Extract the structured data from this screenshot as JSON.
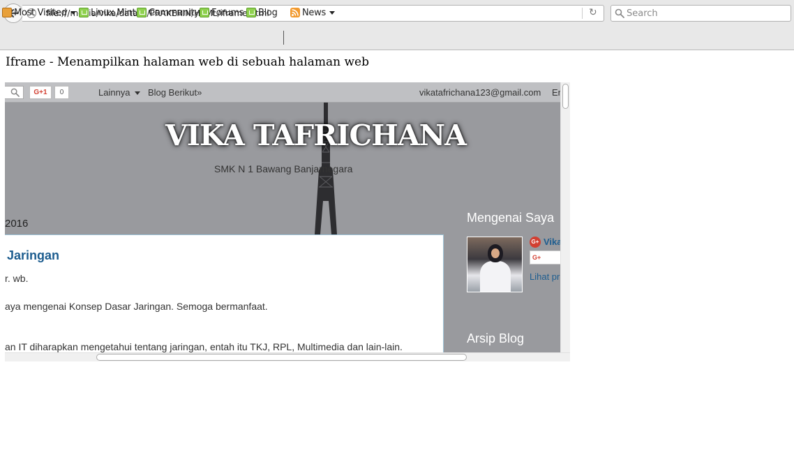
{
  "browser": {
    "url": "file:///media/vika/data D/PRAKERIN/HTML/iframe.html",
    "search_placeholder": "Search",
    "bookmarks": [
      {
        "label": "Most Visited",
        "icon": "folder-icon",
        "dropdown": true
      },
      {
        "label": "Linux Mint",
        "icon": "mint-icon"
      },
      {
        "label": "Community",
        "icon": "mint-icon"
      },
      {
        "label": "Forums",
        "icon": "mint-icon"
      },
      {
        "label": "Blog",
        "icon": "mint-icon"
      },
      {
        "label": "News",
        "icon": "rss-icon",
        "dropdown": true
      }
    ]
  },
  "page": {
    "heading": "Iframe - Menampilkan halaman web di sebuah halaman web"
  },
  "iframe": {
    "navbar": {
      "gplus_label": "G+1",
      "gplus_count": "0",
      "more_label": "Lainnya",
      "next_blog_label": "Blog Berikut»",
      "email": "vikatafrichana123@gmail.com",
      "trailing": "Er"
    },
    "blog": {
      "title": "VIKA TAFRICHANA",
      "description": "SMK N 1 Bawang Banjarnegara"
    },
    "post": {
      "date": "2016",
      "title": "Jaringan",
      "lines": [
        "r. wb.",
        "aya mengenai Konsep Dasar Jaringan. Semoga bermanfaat.",
        "an IT diharapkan mengetahui tentang jaringan, entah itu TKJ, RPL, Multimedia dan lain-lain."
      ]
    },
    "sidebar": {
      "about_heading": "Mengenai Saya",
      "name": "Vika",
      "gplus_follow": "G+",
      "profile_link": "Lihat pr",
      "archive_heading": "Arsip Blog"
    }
  }
}
